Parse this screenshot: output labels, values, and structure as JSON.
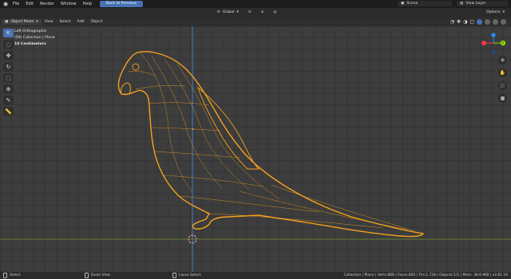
{
  "app_menu": [
    "File",
    "Edit",
    "Render",
    "Window",
    "Help"
  ],
  "back_button": "Back to Previous",
  "scene_label": "Scene",
  "view_layer_label": "View Layer",
  "transform_orientation": "Global",
  "options_label": "Options",
  "viewport_header": {
    "mode": "Object Mode",
    "menus": [
      "View",
      "Select",
      "Add",
      "Object"
    ]
  },
  "overlay": {
    "view_name": "Left Orthographic",
    "collection": "(59) Collection | Plane",
    "unit": "10 Centimeters"
  },
  "tools": [
    "select-box",
    "cursor",
    "move",
    "rotate",
    "scale",
    "transform",
    "annotate",
    "measure"
  ],
  "gizmo_axes": {
    "y_label": "Y",
    "x_color": "#ff3352",
    "y_color": "#8bdc00",
    "z_color": "#2890ff"
  },
  "statusbar": {
    "hint1": "Select",
    "hint2": "Zoom View",
    "hint3": "Lasso Select",
    "info": "Collection | Plane | Verts:868 | Faces:850 | Tris:1,728 | Objects:1/1 | Mem: 38.6 MiB | v2.81.16"
  },
  "colors": {
    "selection": "#f4a11e",
    "accent": "#4772b3",
    "z_axis_line": "#3a7fd9",
    "y_axis_line": "#7a9a2f"
  }
}
